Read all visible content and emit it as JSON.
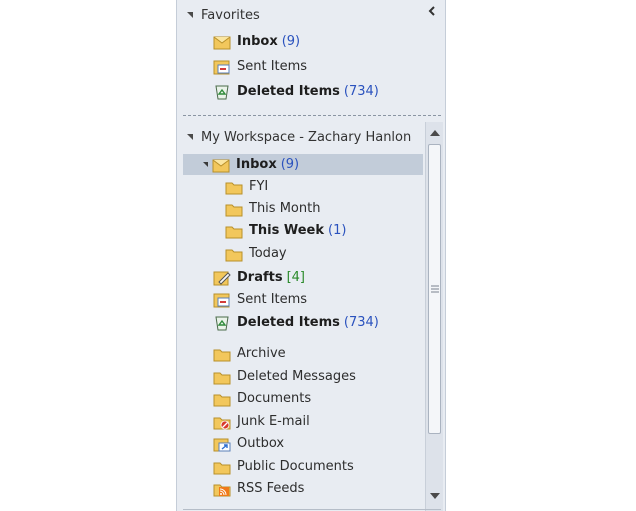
{
  "favorites": {
    "title": "Favorites",
    "items": [
      {
        "label": "Inbox",
        "count": "(9)"
      },
      {
        "label": "Sent Items"
      },
      {
        "label": "Deleted Items",
        "count": "(734)"
      }
    ]
  },
  "workspace": {
    "title": "My Workspace - Zachary Hanlon",
    "inbox": {
      "label": "Inbox",
      "count": "(9)"
    },
    "subfolders": [
      {
        "label": "FYI"
      },
      {
        "label": "This Month"
      },
      {
        "label": "This Week",
        "count": "(1)"
      },
      {
        "label": "Today"
      }
    ],
    "drafts": {
      "label": "Drafts",
      "count": "[4]"
    },
    "sent": {
      "label": "Sent Items"
    },
    "deleted": {
      "label": "Deleted Items",
      "count": "(734)"
    },
    "folders": [
      {
        "label": "Archive",
        "icon": "folder-icon"
      },
      {
        "label": "Deleted Messages",
        "icon": "folder-icon"
      },
      {
        "label": "Documents",
        "icon": "folder-icon"
      },
      {
        "label": "Junk E-mail",
        "icon": "junk-folder-icon"
      },
      {
        "label": "Outbox",
        "icon": "outbox-icon"
      },
      {
        "label": "Public Documents",
        "icon": "folder-icon"
      },
      {
        "label": "RSS Feeds",
        "icon": "rss-icon"
      }
    ]
  },
  "colors": {
    "pane_bg": "#e8ecf2",
    "selection": "#c2ccd9",
    "count_blue": "#2a52be",
    "count_green": "#2a8a2a",
    "folder": "#f2c75c"
  }
}
